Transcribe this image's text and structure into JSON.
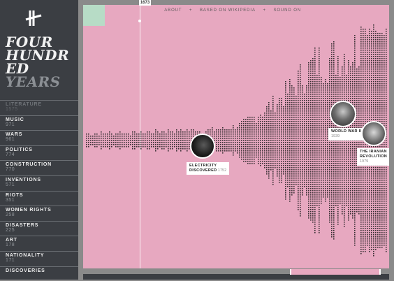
{
  "app": {
    "title_lines": [
      "FOUR",
      "HUNDR",
      "ED",
      "YEARS"
    ],
    "logo_icon": "four-hundred-years-logo-icon"
  },
  "nav": {
    "items": [
      "ABOUT",
      "BASED ON WIKIPEDIA",
      "SOUND ON"
    ],
    "separator": "+"
  },
  "timeline": {
    "year": "1673",
    "window_fraction": [
      0.68,
      0.97
    ]
  },
  "categories": [
    {
      "label": "LITERATURE",
      "count": "1575",
      "dimmed": true
    },
    {
      "label": "MUSIC",
      "count": "971"
    },
    {
      "label": "WARS",
      "count": "961"
    },
    {
      "label": "POLITICS",
      "count": "774"
    },
    {
      "label": "CONSTRUCTION",
      "count": "770"
    },
    {
      "label": "INVENTIONS",
      "count": "571"
    },
    {
      "label": "RIOTS",
      "count": "351"
    },
    {
      "label": "WOMEN RIGHTS",
      "count": "258"
    },
    {
      "label": "DISASTERS",
      "count": "225"
    },
    {
      "label": "ART",
      "count": "178"
    },
    {
      "label": "NATIONALITY",
      "count": "171"
    },
    {
      "label": "DISCOVERIES",
      "count": ""
    }
  ],
  "events": [
    {
      "name": "ELECTRICITY",
      "name2": "DISCOVERED",
      "year": "1752"
    },
    {
      "name": "WORLD WAR II",
      "name2": "",
      "year": "1939"
    },
    {
      "name": "THE IRANIAN",
      "name2": "REVOLUTION",
      "year": "1979"
    }
  ],
  "colors": {
    "background": "#e7a8c0",
    "sidebar": "#3b3e43",
    "dots": "#3a3034",
    "selection": "#b7dcc6"
  }
}
